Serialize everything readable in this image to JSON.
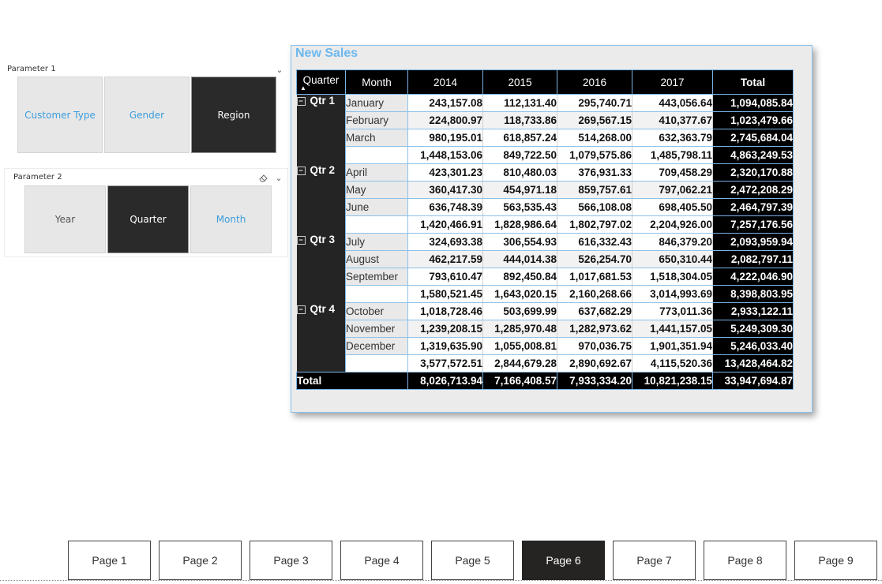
{
  "slicer1": {
    "title": "Parameter 1",
    "options": [
      "Customer Type",
      "Gender",
      "Region"
    ],
    "selected": "Region"
  },
  "slicer2": {
    "title": "Parameter 2",
    "options": [
      "Year",
      "Quarter",
      "Month"
    ],
    "selected": "Quarter"
  },
  "icons": {
    "chevron": "chevron-down-icon",
    "eraser": "eraser-icon",
    "expand_toggle": "collapse-icon"
  },
  "visual": {
    "title": "New Sales",
    "title_color": "#6cb8ef",
    "header": {
      "quarter": "Quarter",
      "month": "Month",
      "years": [
        "2014",
        "2015",
        "2016",
        "2017"
      ],
      "total": "Total"
    },
    "quarters": [
      {
        "label": "Qtr 1",
        "rows": [
          {
            "month": "January",
            "values": [
              "243,157.08",
              "112,131.40",
              "295,740.71",
              "443,056.64"
            ],
            "total": "1,094,085.84"
          },
          {
            "month": "February",
            "values": [
              "224,800.97",
              "118,733.86",
              "269,567.15",
              "410,377.67"
            ],
            "total": "1,023,479.66"
          },
          {
            "month": "March",
            "values": [
              "980,195.01",
              "618,857.24",
              "514,268.00",
              "632,363.79"
            ],
            "total": "2,745,684.04"
          }
        ],
        "subtotal": {
          "values": [
            "1,448,153.06",
            "849,722.50",
            "1,079,575.86",
            "1,485,798.11"
          ],
          "total": "4,863,249.53"
        }
      },
      {
        "label": "Qtr 2",
        "rows": [
          {
            "month": "April",
            "values": [
              "423,301.23",
              "810,480.03",
              "376,931.33",
              "709,458.29"
            ],
            "total": "2,320,170.88"
          },
          {
            "month": "May",
            "values": [
              "360,417.30",
              "454,971.18",
              "859,757.61",
              "797,062.21"
            ],
            "total": "2,472,208.29"
          },
          {
            "month": "June",
            "values": [
              "636,748.39",
              "563,535.43",
              "566,108.08",
              "698,405.50"
            ],
            "total": "2,464,797.39"
          }
        ],
        "subtotal": {
          "values": [
            "1,420,466.91",
            "1,828,986.64",
            "1,802,797.02",
            "2,204,926.00"
          ],
          "total": "7,257,176.56"
        }
      },
      {
        "label": "Qtr 3",
        "rows": [
          {
            "month": "July",
            "values": [
              "324,693.38",
              "306,554.93",
              "616,332.43",
              "846,379.20"
            ],
            "total": "2,093,959.94"
          },
          {
            "month": "August",
            "values": [
              "462,217.59",
              "444,014.38",
              "526,254.70",
              "650,310.44"
            ],
            "total": "2,082,797.11"
          },
          {
            "month": "September",
            "values": [
              "793,610.47",
              "892,450.84",
              "1,017,681.53",
              "1,518,304.05"
            ],
            "total": "4,222,046.90"
          }
        ],
        "subtotal": {
          "values": [
            "1,580,521.45",
            "1,643,020.15",
            "2,160,268.66",
            "3,014,993.69"
          ],
          "total": "8,398,803.95"
        }
      },
      {
        "label": "Qtr 4",
        "rows": [
          {
            "month": "October",
            "values": [
              "1,018,728.46",
              "503,699.99",
              "637,682.29",
              "773,011.36"
            ],
            "total": "2,933,122.11"
          },
          {
            "month": "November",
            "values": [
              "1,239,208.15",
              "1,285,970.48",
              "1,282,973.62",
              "1,441,157.05"
            ],
            "total": "5,249,309.30"
          },
          {
            "month": "December",
            "values": [
              "1,319,635.90",
              "1,055,008.81",
              "970,036.75",
              "1,901,351.94"
            ],
            "total": "5,246,033.40"
          }
        ],
        "subtotal": {
          "values": [
            "3,577,572.51",
            "2,844,679.28",
            "2,890,692.67",
            "4,115,520.36"
          ],
          "total": "13,428,464.82"
        }
      }
    ],
    "grand_total": {
      "label": "Total",
      "values": [
        "8,026,713.94",
        "7,166,408.57",
        "7,933,334.20",
        "10,821,238.15"
      ],
      "total": "33,947,694.87"
    }
  },
  "pages": {
    "tabs": [
      "Page 1",
      "Page 2",
      "Page 3",
      "Page 4",
      "Page 5",
      "Page 6",
      "Page 7",
      "Page 8",
      "Page 9"
    ],
    "active": "Page 6"
  }
}
